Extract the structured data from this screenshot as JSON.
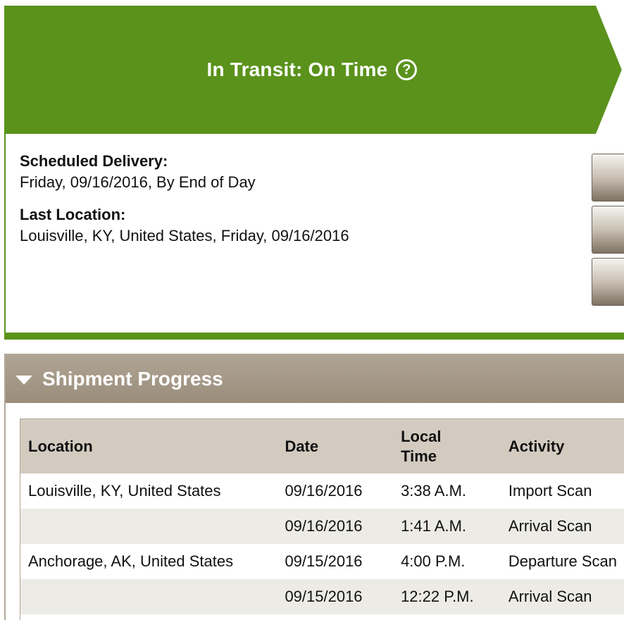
{
  "status": {
    "title": "In Transit: On Time",
    "help_icon": "question-circle-icon",
    "scheduled_delivery_label": "Scheduled Delivery:",
    "scheduled_delivery_value": "Friday, 09/16/2016, By End of Day",
    "last_location_label": "Last Location:",
    "last_location_value": "Louisville, KY, United States, Friday, 09/16/2016"
  },
  "progress": {
    "title": "Shipment Progress",
    "toggle_icon": "caret-down-icon",
    "columns": {
      "location": "Location",
      "date": "Date",
      "local_time_line1": "Local",
      "local_time_line2": "Time",
      "activity": "Activity"
    },
    "rows": [
      {
        "location": "Louisville, KY, United States",
        "date": "09/16/2016",
        "time": "3:38 A.M.",
        "activity": "Import Scan"
      },
      {
        "location": "",
        "date": "09/16/2016",
        "time": "1:41 A.M.",
        "activity": "Arrival Scan"
      },
      {
        "location": "Anchorage, AK, United States",
        "date": "09/15/2016",
        "time": "4:00 P.M.",
        "activity": "Departure Scan"
      },
      {
        "location": "",
        "date": "09/15/2016",
        "time": "12:22 P.M.",
        "activity": "Arrival Scan"
      }
    ]
  },
  "colors": {
    "status_green": "#5a921b",
    "progress_header": "#9a8d7c",
    "table_header_bg": "#d3cbbf",
    "row_alt_bg": "#ecebe6"
  }
}
